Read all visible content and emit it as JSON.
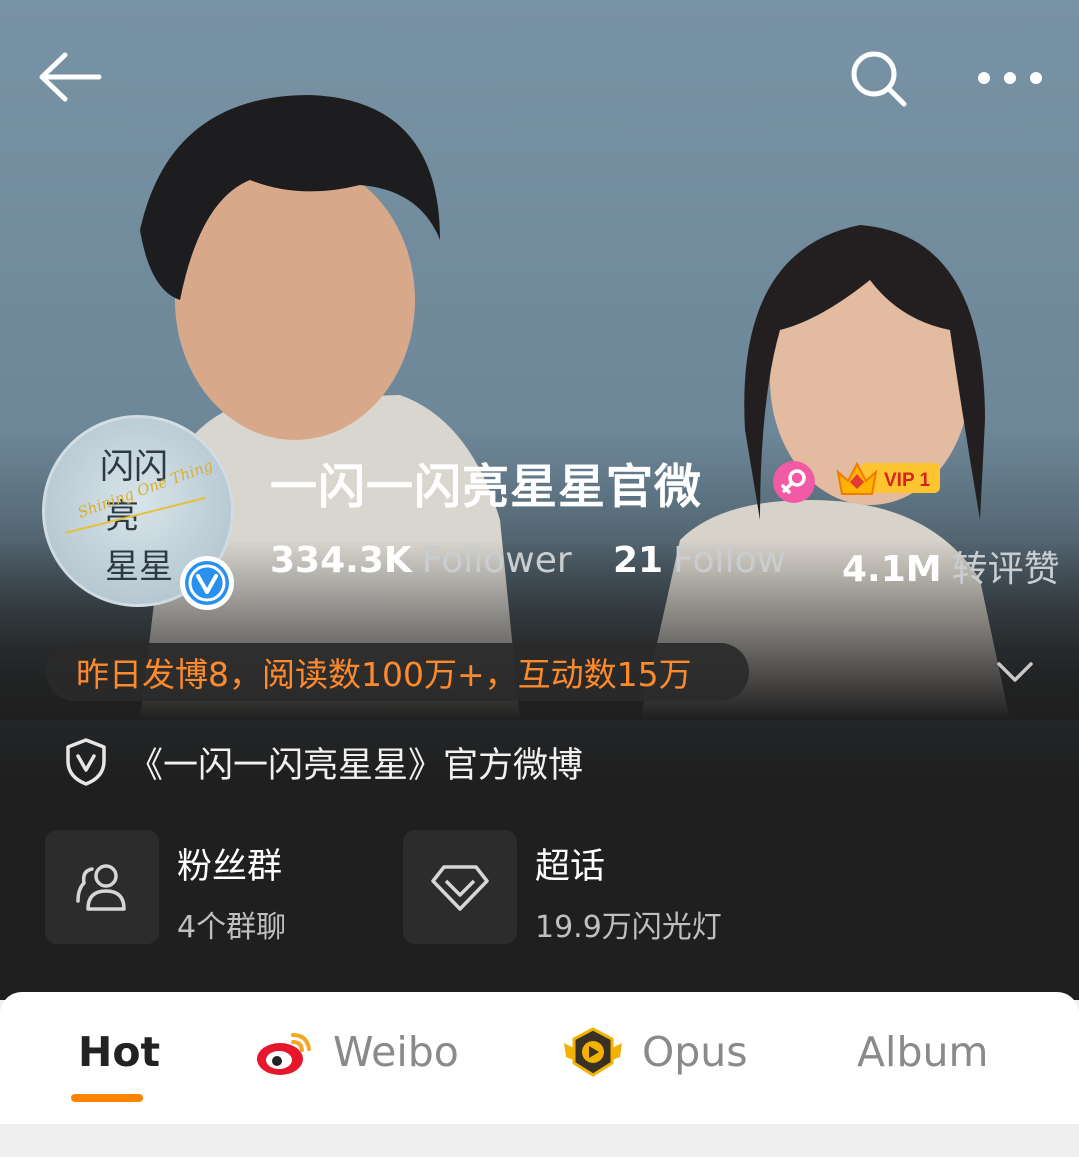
{
  "topbar": {
    "back_icon": "arrow-left-icon",
    "search_icon": "search-icon",
    "more_icon": "more-horizontal-icon"
  },
  "profile": {
    "name": "一闪一闪亮星星官微",
    "avatar_text": "闪闪亮星星",
    "avatar_script": "Shining One Thing",
    "verified_icon": "verified-v-icon",
    "gender_icon": "female-icon",
    "vip_label": "VIP 1",
    "stats": [
      {
        "value": "334.3K",
        "label": "Follower"
      },
      {
        "value": "21",
        "label": "Follow"
      },
      {
        "value": "4.1M",
        "label": "转评赞"
      }
    ]
  },
  "activity": {
    "text": "昨日发博8，阅读数100万+，互动数15万"
  },
  "bio": {
    "text": "《一闪一闪亮星星》官方微博"
  },
  "features": [
    {
      "title": "粉丝群",
      "subtitle": "4个群聊",
      "icon": "people-group-icon"
    },
    {
      "title": "超话",
      "subtitle": "19.9万闪光灯",
      "icon": "diamond-icon"
    }
  ],
  "tabs": [
    {
      "label": "Hot",
      "active": true
    },
    {
      "label": "Weibo",
      "icon": "weibo-logo-icon"
    },
    {
      "label": "Opus",
      "icon": "play-badge-icon"
    },
    {
      "label": "Album"
    }
  ],
  "colors": {
    "accent_orange": "#ff8200",
    "activity_text": "#ff8a2b",
    "dark_bg": "#1f1f1f"
  }
}
